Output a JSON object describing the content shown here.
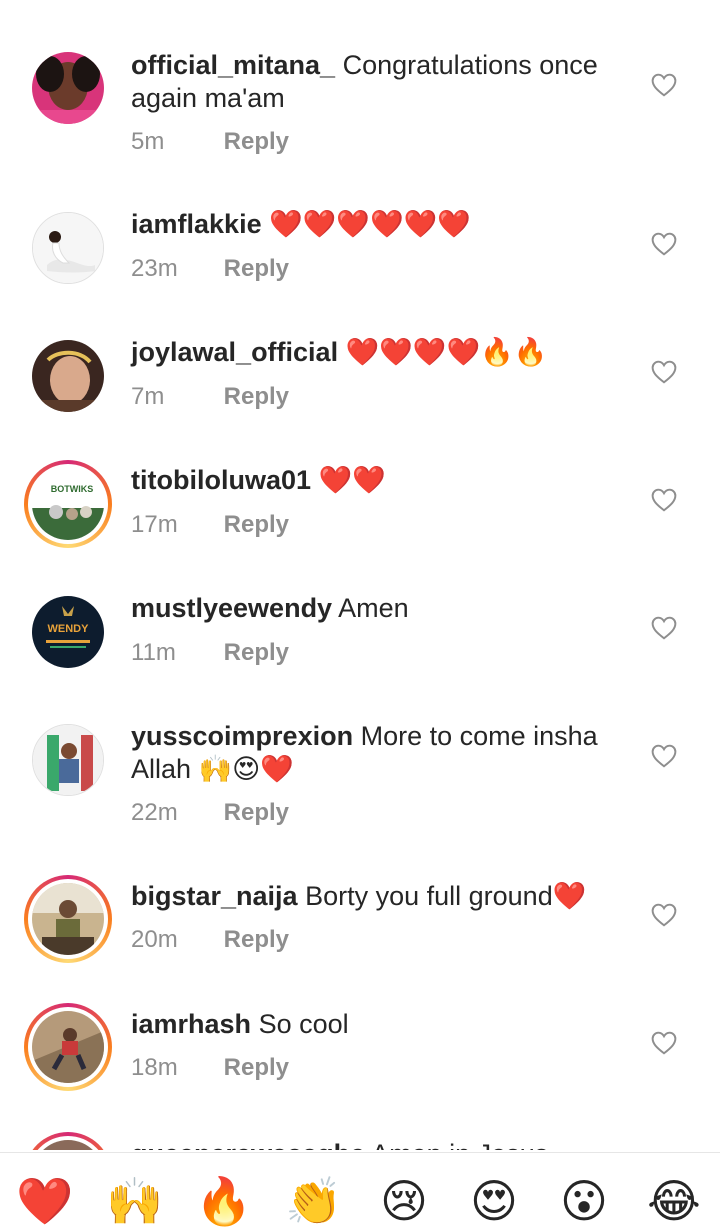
{
  "comments": [
    {
      "username": "official_mitana_",
      "text": "Congratulations once again ma'am",
      "time": "5m",
      "reply": "Reply"
    },
    {
      "username": "iamflakkie",
      "text": "❤️❤️❤️❤️❤️❤️",
      "time": "23m",
      "reply": "Reply"
    },
    {
      "username": "joylawal_official",
      "text": "❤️❤️❤️❤️🔥🔥",
      "time": "7m",
      "reply": "Reply"
    },
    {
      "username": "titobiloluwa01",
      "text": "❤️❤️",
      "time": "17m",
      "reply": "Reply",
      "avatar_text": "BOTWIKS"
    },
    {
      "username": "mustlyeewendy",
      "text": "Amen",
      "time": "11m",
      "reply": "Reply",
      "avatar_text": "WENDY"
    },
    {
      "username": "yusscoimprexion",
      "text": "More to come insha Allah 🙌😍❤️",
      "time": "22m",
      "reply": "Reply"
    },
    {
      "username": "bigstar_naija",
      "text": "Borty you full ground❤️",
      "time": "20m",
      "reply": "Reply"
    },
    {
      "username": "iamrhash",
      "text": "So cool",
      "time": "18m",
      "reply": "Reply"
    },
    {
      "username": "queenerewaaagbe",
      "text": "Amen in Jesus"
    }
  ],
  "quick_reactions": [
    "❤️",
    "🙌",
    "🔥",
    "👏",
    "😢",
    "😍",
    "😮",
    "😂"
  ],
  "icons": {
    "like": "heart-outline-icon"
  },
  "colors": {
    "text": "#262626",
    "meta": "#8e8e8e",
    "story_ring_start": "#d62976",
    "story_ring_end": "#fa7e1e"
  }
}
